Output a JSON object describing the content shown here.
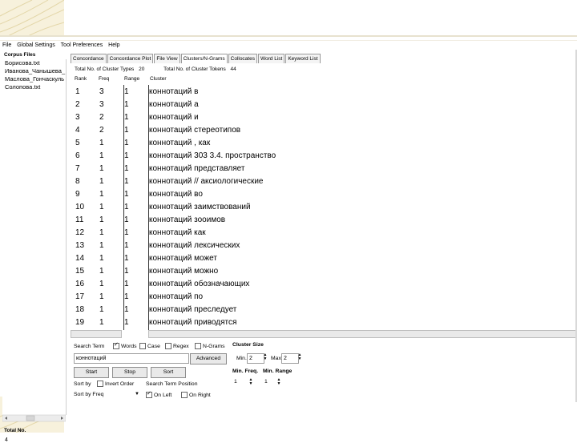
{
  "menu": [
    "File",
    "Global Settings",
    "Tool Preferences",
    "Help"
  ],
  "sidebar": {
    "title": "Corpus Files",
    "files": [
      "Борисова.txt",
      "Иванова_Чанышева_",
      "Маслова_Гончаскуль",
      "Солопова.txt"
    ],
    "total_label": "Total No.",
    "total_value": "4"
  },
  "tabs": [
    "Concordance",
    "Concordance Plot",
    "File View",
    "Clusters/N-Grams",
    "Collocates",
    "Word List",
    "Keyword List"
  ],
  "active_tab": "Clusters/N-Grams",
  "summary": {
    "types_label": "Total No. of Cluster Types",
    "types_value": "20",
    "tokens_label": "Total No. of Cluster Tokens",
    "tokens_value": "44"
  },
  "columns": {
    "rank": "Rank",
    "freq": "Freq",
    "range": "Range",
    "cluster": "Cluster"
  },
  "rows": [
    {
      "rank": "1",
      "freq": "3",
      "range": "1",
      "cluster": "коннотаций в"
    },
    {
      "rank": "2",
      "freq": "3",
      "range": "1",
      "cluster": "коннотаций а"
    },
    {
      "rank": "3",
      "freq": "2",
      "range": "1",
      "cluster": "коннотаций и"
    },
    {
      "rank": "4",
      "freq": "2",
      "range": "1",
      "cluster": "коннотаций стереотипов"
    },
    {
      "rank": "5",
      "freq": "1",
      "range": "1",
      "cluster": "коннотаций , как"
    },
    {
      "rank": "6",
      "freq": "1",
      "range": "1",
      "cluster": "коннотаций 303 3.4. пространство"
    },
    {
      "rank": "7",
      "freq": "1",
      "range": "1",
      "cluster": "коннотаций представляет"
    },
    {
      "rank": "8",
      "freq": "1",
      "range": "1",
      "cluster": "коннотаций // аксиологические"
    },
    {
      "rank": "9",
      "freq": "1",
      "range": "1",
      "cluster": "коннотаций во"
    },
    {
      "rank": "10",
      "freq": "1",
      "range": "1",
      "cluster": "коннотаций заимствований"
    },
    {
      "rank": "11",
      "freq": "1",
      "range": "1",
      "cluster": "коннотаций зооимов"
    },
    {
      "rank": "12",
      "freq": "1",
      "range": "1",
      "cluster": "коннотаций как"
    },
    {
      "rank": "13",
      "freq": "1",
      "range": "1",
      "cluster": "коннотаций лексических"
    },
    {
      "rank": "14",
      "freq": "1",
      "range": "1",
      "cluster": "коннотаций может"
    },
    {
      "rank": "15",
      "freq": "1",
      "range": "1",
      "cluster": "коннотаций можно"
    },
    {
      "rank": "16",
      "freq": "1",
      "range": "1",
      "cluster": "коннотаций обозначающих"
    },
    {
      "rank": "17",
      "freq": "1",
      "range": "1",
      "cluster": "коннотаций по"
    },
    {
      "rank": "18",
      "freq": "1",
      "range": "1",
      "cluster": "коннотаций преследует"
    },
    {
      "rank": "19",
      "freq": "1",
      "range": "1",
      "cluster": "коннотаций приводятся"
    }
  ],
  "controls": {
    "search_term_label": "Search Term",
    "opt_words": "Words",
    "opt_case": "Case",
    "opt_regex": "Regex",
    "opt_ngrams": "N-Grams",
    "search_value": "коннотаций",
    "advanced_label": "Advanced",
    "cluster_size_label": "Cluster Size",
    "min_label": "Min.",
    "min_value": "2",
    "max_label": "Max.",
    "max_value": "2",
    "start_label": "Start",
    "stop_label": "Stop",
    "sort_label": "Sort",
    "sort_by_label": "Sort by",
    "invert_order_label": "Invert Order",
    "search_pos_label": "Search Term Position",
    "on_left_label": "On Left",
    "on_right_label": "On Right",
    "sort_select_value": "Sort by Freq",
    "min_freq_label": "Min. Freq.",
    "min_freq_value": "1",
    "min_range_label": "Min. Range",
    "min_range_value": "1"
  }
}
